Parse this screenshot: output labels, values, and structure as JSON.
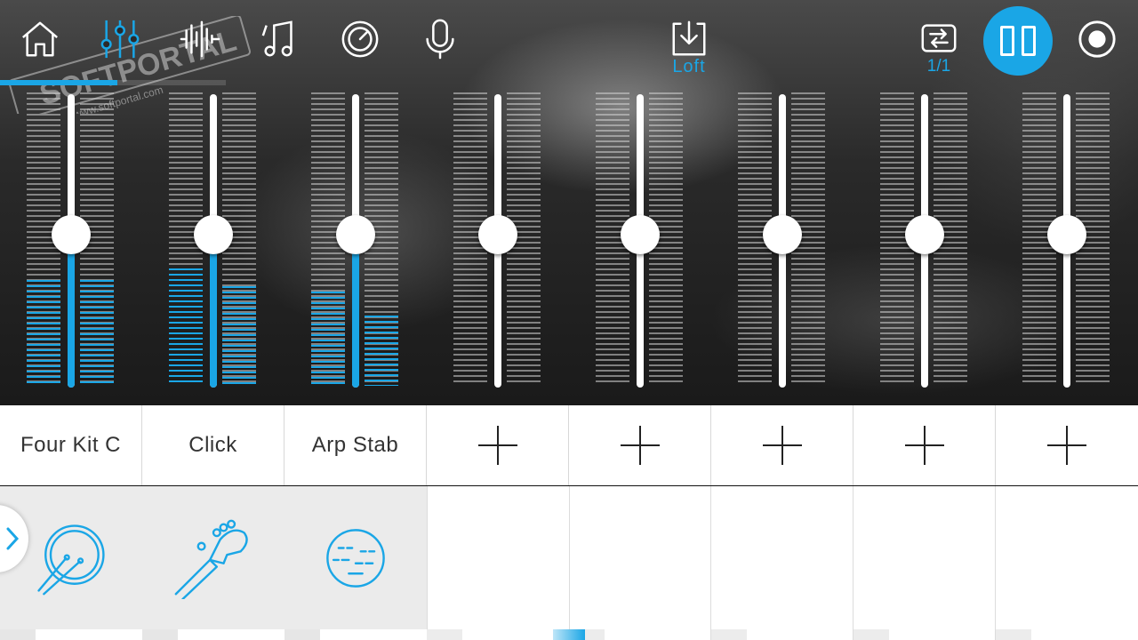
{
  "colors": {
    "accent": "#1aa6e6",
    "meter_idle": "#cfcfcf",
    "name_text": "#333333"
  },
  "toolbar": {
    "icons": [
      "home-icon",
      "mixer-icon",
      "waveform-icon",
      "music-notes-icon",
      "knob-icon",
      "microphone-icon",
      "download-icon",
      "loop-icon",
      "pause-icon",
      "record-icon"
    ],
    "preset_name": "Loft",
    "loop_counter": "1/1"
  },
  "playback": {
    "progress_fraction": 0.52
  },
  "channels": [
    {
      "name": "Four Kit C",
      "fader_level": 0.52,
      "meter_left": 0.36,
      "meter_right": 0.36
    },
    {
      "name": "Click",
      "fader_level": 0.52,
      "meter_left": 0.4,
      "meter_right": 0.34
    },
    {
      "name": "Arp Stab",
      "fader_level": 0.52,
      "meter_left": 0.32,
      "meter_right": 0.24
    },
    {
      "name": "",
      "fader_level": 0.52,
      "meter_left": 0,
      "meter_right": 0
    },
    {
      "name": "",
      "fader_level": 0.52,
      "meter_left": 0,
      "meter_right": 0
    },
    {
      "name": "",
      "fader_level": 0.52,
      "meter_left": 0,
      "meter_right": 0
    },
    {
      "name": "",
      "fader_level": 0.52,
      "meter_left": 0,
      "meter_right": 0
    },
    {
      "name": "",
      "fader_level": 0.52,
      "meter_left": 0,
      "meter_right": 0
    }
  ],
  "instruments": [
    "drum-kit-icon",
    "guitar-headstock-icon",
    "synth-face-icon"
  ],
  "watermark": {
    "brand": "SOFTPORTAL",
    "url": "www.softportal.com"
  }
}
